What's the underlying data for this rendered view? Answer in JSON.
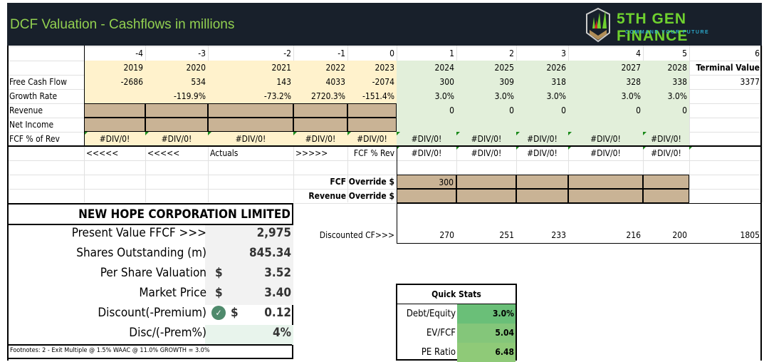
{
  "header": {
    "title": "DCF Valuation - Cashflows in millions",
    "logo": {
      "brand": "5TH GEN FINANCE",
      "tagline": "COMMAND YOUR FUTURE"
    }
  },
  "grid": {
    "periods": [
      "-4",
      "-3",
      "-2",
      "-1",
      "0",
      "1",
      "2",
      "3",
      "4",
      "5",
      "6"
    ],
    "years": [
      "2019",
      "2020",
      "2021",
      "2022",
      "2023",
      "2024",
      "2025",
      "2026",
      "2027",
      "2028",
      "Terminal Value"
    ],
    "rows": [
      {
        "label": "Free Cash Flow",
        "values": [
          "-2686",
          "534",
          "143",
          "4033",
          "-2074",
          "300",
          "309",
          "318",
          "328",
          "338",
          "3377"
        ]
      },
      {
        "label": "Growth Rate",
        "values": [
          "",
          "-119.9%",
          "-73.2%",
          "2720.3%",
          "-151.4%",
          "3.0%",
          "3.0%",
          "3.0%",
          "3.0%",
          "3.0%",
          ""
        ]
      },
      {
        "label": "Revenue",
        "values": [
          "",
          "",
          "",
          "",
          "",
          "0",
          "0",
          "0",
          "0",
          "0",
          ""
        ]
      },
      {
        "label": "Net Income",
        "values": [
          "",
          "",
          "",
          "",
          "",
          "",
          "",
          "",
          "",
          "",
          ""
        ]
      },
      {
        "label": "FCF % of Rev",
        "values": [
          "#DIV/0!",
          "#DIV/0!",
          "#DIV/0!",
          "#DIV/0!",
          "#DIV/0!",
          "#DIV/0!",
          "#DIV/0!",
          "#DIV/0!",
          "#DIV/0!",
          "#DIV/0!",
          ""
        ]
      }
    ],
    "arrows_row": [
      "<<<<<",
      "<<<<<",
      "Actuals",
      ">>>>>",
      "FCF % Rev",
      "#DIV/0!",
      "#DIV/0!",
      "#DIV/0!",
      "#DIV/0!",
      "#DIV/0!",
      ""
    ],
    "fcf_override": {
      "label": "FCF Override $",
      "value": "300"
    },
    "revenue_override": {
      "label": "Revenue Override $"
    },
    "discounted_cf": {
      "label": "Discounted CF>>>",
      "values": [
        "270",
        "251",
        "233",
        "216",
        "200",
        "1805"
      ]
    }
  },
  "summary": {
    "company": "NEW HOPE CORPORATION LIMITED",
    "rows": [
      {
        "label": "Present Value FFCF >>>",
        "currency": "",
        "value": "2,975"
      },
      {
        "label": "Shares Outstanding (m)",
        "currency": "",
        "value": "845.34"
      },
      {
        "label": "Per Share Valuation",
        "currency": "$",
        "value": "3.52"
      },
      {
        "label": "Market Price",
        "currency": "$",
        "value": "3.40"
      },
      {
        "label": "Discount(-Premium)",
        "currency": "$",
        "value": "0.12",
        "icon": "check-circle-icon"
      },
      {
        "label": "Disc/(-Prem%)",
        "currency": "",
        "value": "4%"
      }
    ],
    "footnote": "Footnotes: 2 - Exit Multiple @ 1.5% WAAC @ 11.0% GROWTH = 3.0%"
  },
  "quick_stats": {
    "title": "Quick Stats",
    "items": [
      {
        "label": "Debt/Equity",
        "value": "3.0%",
        "color": "#6abf78"
      },
      {
        "label": "EV/FCF",
        "value": "5.04",
        "color": "#84c67a"
      },
      {
        "label": "PE Ratio",
        "value": "6.48",
        "color": "#8fca78"
      }
    ]
  },
  "colors": {
    "header_bg": "#18202b",
    "title": "#92d050",
    "actuals_bg": "#fff2cc",
    "forecast_bg": "#e2efda",
    "input_bg": "#c9b395"
  }
}
